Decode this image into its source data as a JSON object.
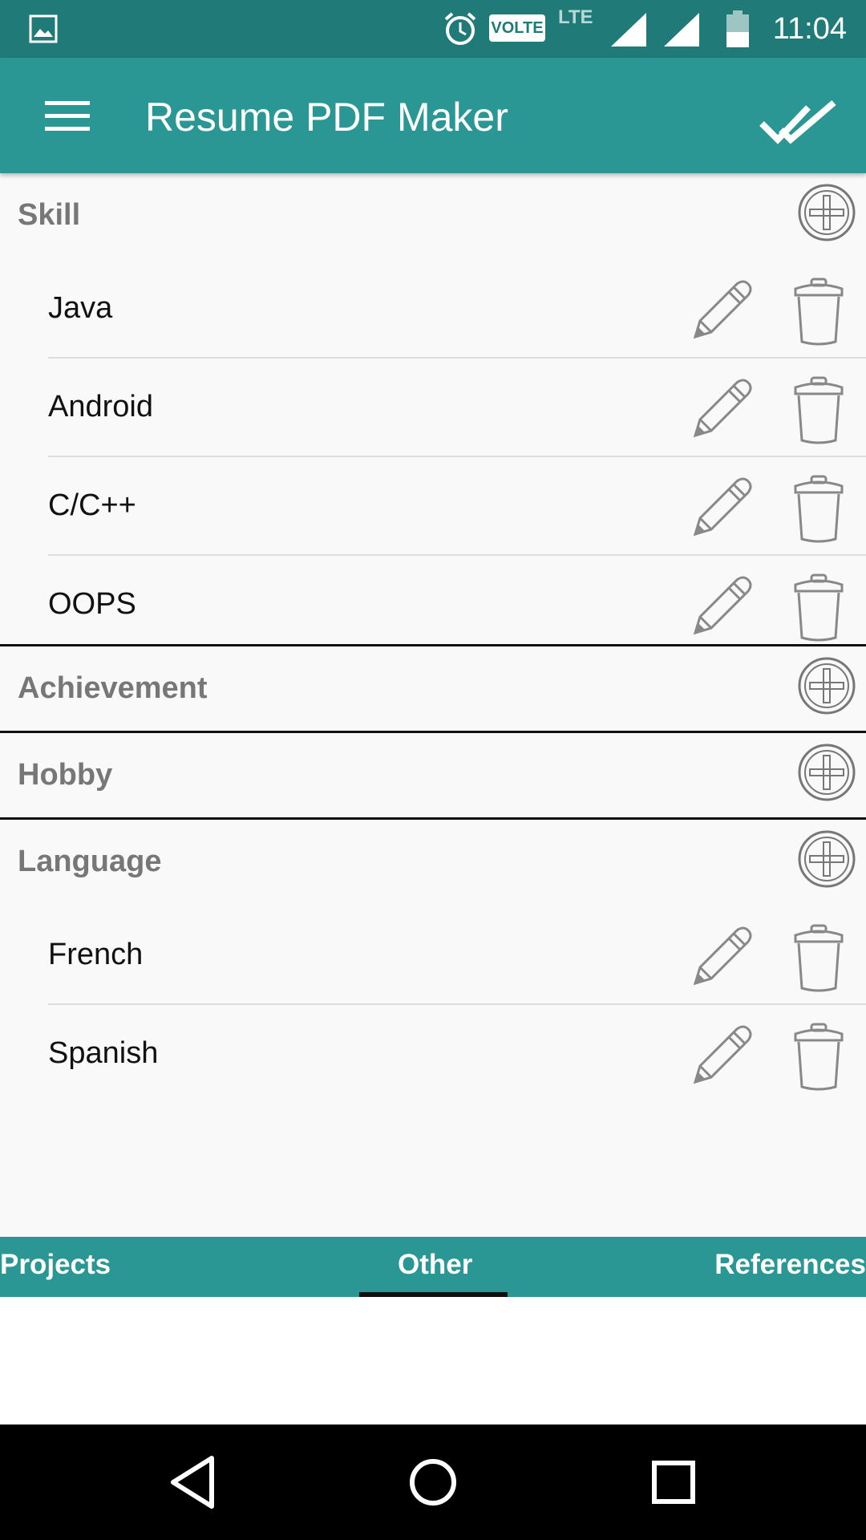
{
  "status_bar": {
    "time": "11:04",
    "icons": [
      "gallery-icon",
      "alarm-icon",
      "volte-icon",
      "lte-icon",
      "signal-icon",
      "signal-icon",
      "battery-icon"
    ],
    "volte_label": "VOLTE",
    "lte_label": "LTE"
  },
  "app_bar": {
    "title": "Resume PDF Maker",
    "menu_icon": "hamburger-menu-icon",
    "done_icon": "double-check-icon"
  },
  "sections": [
    {
      "title": "Skill",
      "items": [
        "Java",
        "Android",
        "C/C++",
        "OOPS"
      ]
    },
    {
      "title": "Achievement",
      "items": []
    },
    {
      "title": "Hobby",
      "items": []
    },
    {
      "title": "Language",
      "items": [
        "French",
        "Spanish"
      ]
    }
  ],
  "tabs": {
    "left": "Projects",
    "center": "Other",
    "right": "References",
    "selected": "Other"
  },
  "nav_bar": {
    "icons": [
      "back-icon",
      "home-icon",
      "recents-icon"
    ]
  },
  "colors": {
    "status_bar": "#1f7a78",
    "primary": "#2b9794",
    "background": "#f9f9f9",
    "section_title": "#777777"
  }
}
